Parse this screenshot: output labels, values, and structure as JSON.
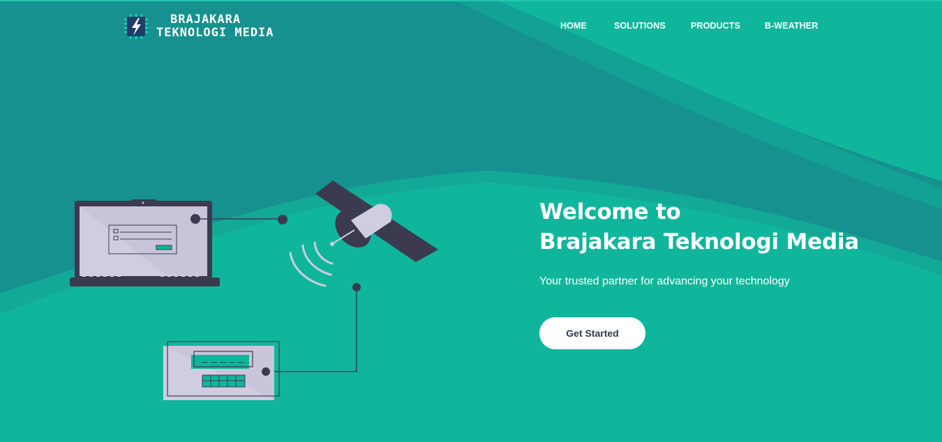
{
  "brand": {
    "line1": "BRAJAKARA",
    "line2": "TEKNOLOGI MEDIA",
    "logo_icon": "lightning-chip-icon"
  },
  "nav": {
    "items": [
      {
        "label": "HOME"
      },
      {
        "label": "SOLUTIONS"
      },
      {
        "label": "PRODUCTS"
      },
      {
        "label": "B-WEATHER"
      }
    ]
  },
  "hero": {
    "title_line1": "Welcome to",
    "title_line2": "Brajakara Teknologi Media",
    "subtitle": "Your trusted partner for advancing your technology",
    "cta_label": "Get Started"
  },
  "illustration": {
    "icons": [
      "laptop-icon",
      "satellite-icon",
      "signal-waves-icon",
      "terminal-device-icon"
    ]
  },
  "colors": {
    "background": "#10b69c",
    "wave_dark": "#16918f",
    "wave_light": "#12a996",
    "device_dark": "#3b3a4f",
    "device_light": "#d0cde0",
    "text": "#ffffff",
    "button_text": "#333846"
  }
}
